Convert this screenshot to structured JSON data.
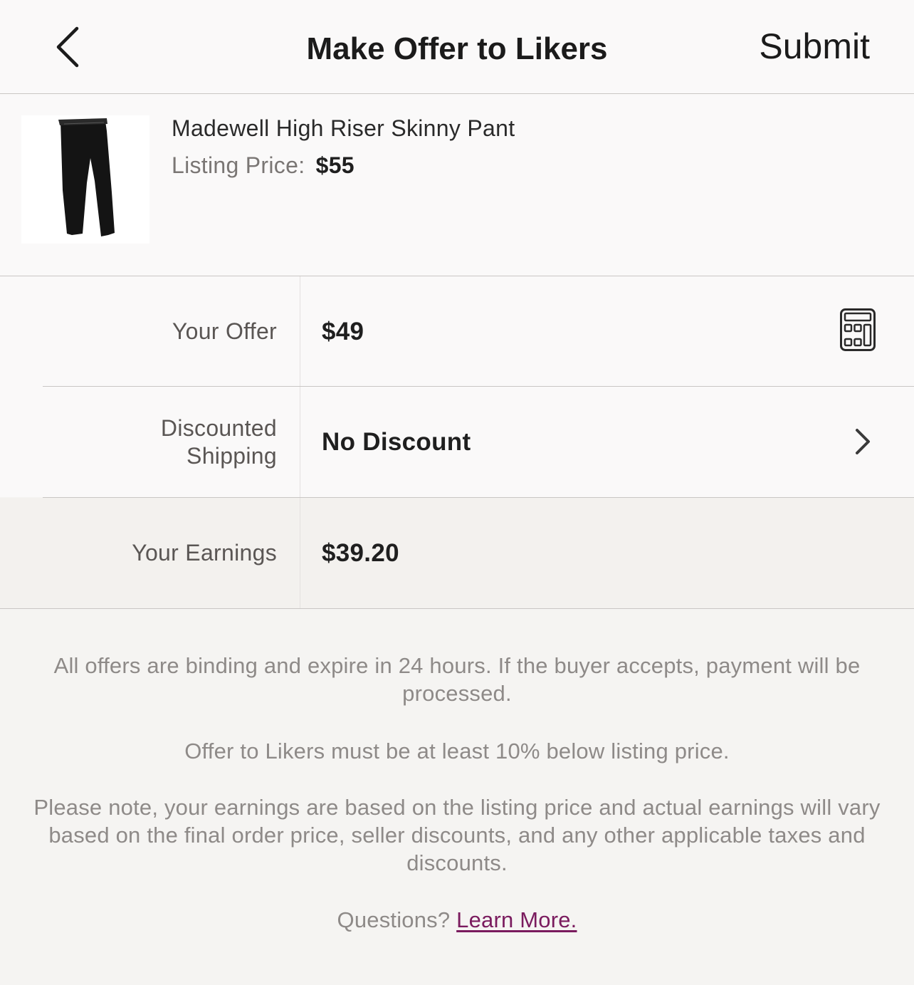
{
  "header": {
    "title": "Make Offer to Likers",
    "submit_label": "Submit",
    "back_icon": "chevron-left-icon"
  },
  "listing": {
    "name": "Madewell High Riser Skinny Pant",
    "price_label": "Listing Price:",
    "price_value": "$55"
  },
  "form": {
    "offer_label": "Your Offer",
    "offer_value": "$49",
    "calculator_icon": "calculator-icon",
    "shipping_label_line1": "Discounted",
    "shipping_label_line2": "Shipping",
    "shipping_value": "No Discount",
    "shipping_icon": "chevron-right-icon",
    "earnings_label": "Your Earnings",
    "earnings_value": "$39.20"
  },
  "notes": {
    "binding": "All offers are binding and expire in 24 hours. If the buyer accepts, payment will be processed.",
    "min_discount": "Offer to Likers must be at least 10% below listing price.",
    "earnings_note": "Please note, your earnings are based on the listing price and actual earnings will vary based on the final order price, seller discounts, and any other applicable taxes and discounts.",
    "questions": "Questions?",
    "learn_more": "Learn More."
  },
  "colors": {
    "link": "#7a1b5e",
    "header_bg": "#faf9f9",
    "page_bg": "#f5f4f2",
    "earnings_bg": "#f3f1ee"
  }
}
